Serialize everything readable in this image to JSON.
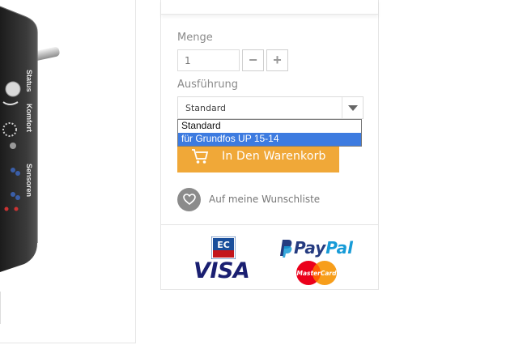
{
  "product_image": {
    "labels": [
      "Status",
      "Komfort",
      "Sensoren"
    ]
  },
  "form": {
    "quantity_label": "Menge",
    "quantity_value": "1",
    "minus_label": "−",
    "plus_label": "+",
    "variant_label": "Ausführung",
    "variant_selected": "Standard",
    "variant_options": [
      "Standard",
      "für Grundfos UP 15-14"
    ],
    "highlighted_option_index": 1
  },
  "actions": {
    "add_to_cart": "In Den Warenkorb",
    "wishlist": "Auf meine Wunschliste"
  },
  "payments": {
    "paypal_part1": "Pay",
    "paypal_part2": "Pal",
    "visa": "VISA",
    "mastercard": "MasterCard"
  },
  "colors": {
    "cart_button": "#f0a838",
    "highlight": "#3d7be0",
    "paypal_dark": "#253b80",
    "paypal_light": "#179bd7",
    "visa": "#1a1f71"
  }
}
